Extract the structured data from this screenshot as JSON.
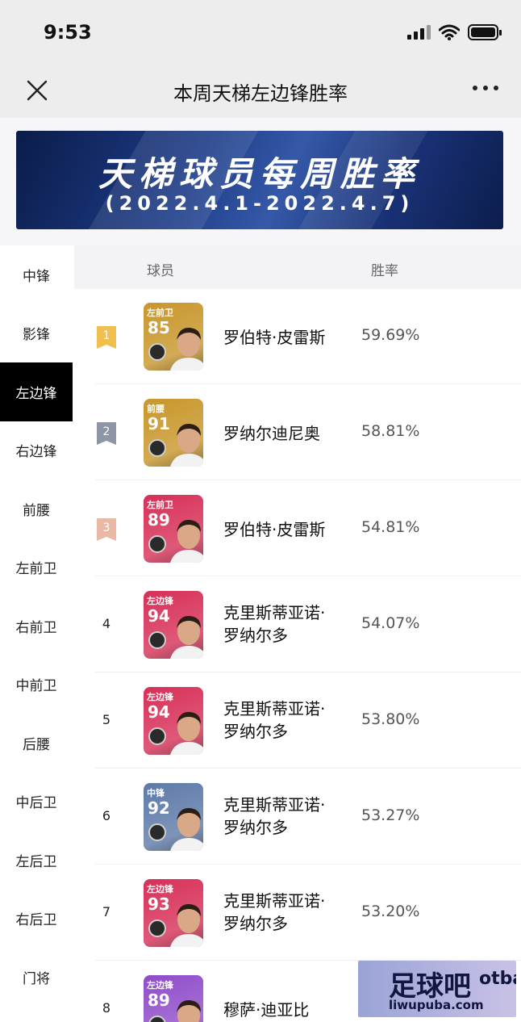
{
  "status_bar": {
    "time": "9:53"
  },
  "nav": {
    "title": "本周天梯左边锋胜率"
  },
  "banner": {
    "title": "天梯球员每周胜率",
    "subtitle": "(2022.4.1-2022.4.7)"
  },
  "sidebar": {
    "active_index": 2,
    "items": [
      "中锋",
      "影锋",
      "左边锋",
      "右边锋",
      "前腰",
      "左前卫",
      "右前卫",
      "中前卫",
      "后腰",
      "中后卫",
      "左后卫",
      "右后卫",
      "门将"
    ]
  },
  "table": {
    "header_player": "球员",
    "header_rate": "胜率",
    "rows": [
      {
        "rank": "1",
        "badge_color": "#f0bf4f",
        "card_pos": "左前卫",
        "card_rating": "85",
        "card_color": "#c8962a",
        "name_line1": "罗伯特·皮雷斯",
        "name_line2": "",
        "rate": "59.69%"
      },
      {
        "rank": "2",
        "badge_color": "#8e95a6",
        "card_pos": "前腰",
        "card_rating": "91",
        "card_color": "#c8962a",
        "name_line1": "罗纳尔迪尼奥",
        "name_line2": "",
        "rate": "58.81%"
      },
      {
        "rank": "3",
        "badge_color": "#e9b9a6",
        "card_pos": "左前卫",
        "card_rating": "89",
        "card_color": "#d72f57",
        "name_line1": "罗伯特·皮雷斯",
        "name_line2": "",
        "rate": "54.81%"
      },
      {
        "rank": "4",
        "badge_color": "",
        "card_pos": "左边锋",
        "card_rating": "94",
        "card_color": "#d72f57",
        "name_line1": "克里斯蒂亚诺·",
        "name_line2": "罗纳尔多",
        "rate": "54.07%"
      },
      {
        "rank": "5",
        "badge_color": "",
        "card_pos": "左边锋",
        "card_rating": "94",
        "card_color": "#d72f57",
        "name_line1": "克里斯蒂亚诺·",
        "name_line2": "罗纳尔多",
        "rate": "53.80%"
      },
      {
        "rank": "6",
        "badge_color": "",
        "card_pos": "中锋",
        "card_rating": "92",
        "card_color": "#5d7aa8",
        "name_line1": "克里斯蒂亚诺·",
        "name_line2": "罗纳尔多",
        "rate": "53.27%"
      },
      {
        "rank": "7",
        "badge_color": "",
        "card_pos": "左边锋",
        "card_rating": "93",
        "card_color": "#d72f57",
        "name_line1": "克里斯蒂亚诺·",
        "name_line2": "罗纳尔多",
        "rate": "53.20%"
      },
      {
        "rank": "8",
        "badge_color": "",
        "card_pos": "左边锋",
        "card_rating": "89",
        "card_color": "#8f4cc9",
        "name_line1": "穆萨·迪亚比",
        "name_line2": "",
        "rate": ""
      }
    ]
  },
  "watermark": {
    "main": "足球吧",
    "side": "otba",
    "url": "liwupuba.com"
  }
}
